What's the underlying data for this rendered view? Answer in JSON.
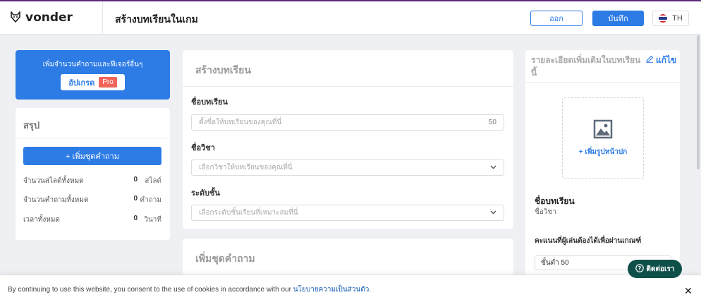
{
  "header": {
    "brand": "vonder",
    "page_title": "สร้างบทเรียนในเกม",
    "exit_label": "ออก",
    "save_label": "บันทึก",
    "language": "TH"
  },
  "upgrade": {
    "text": "เพิ่มจำนวนคำถามและฟีเจอร์อื่นๆ",
    "button_label": "อัปเกรด",
    "badge": "Pro"
  },
  "summary": {
    "title": "สรุป",
    "add_button": "+ เพิ่มชุดคำถาม",
    "stats": [
      {
        "label": "จำนวนสไลด์ทั้งหมด",
        "value": "0",
        "unit": "สไลด์"
      },
      {
        "label": "จำนวนคำถามทั้งหมด",
        "value": "0",
        "unit": "คำถาม"
      },
      {
        "label": "เวลาทั้งหมด",
        "value": "0",
        "unit": "วินาที"
      }
    ]
  },
  "lesson_form": {
    "title": "สร้างบทเรียน",
    "name_label": "ชื่อบทเรียน",
    "name_placeholder": "ตั้งชื่อให้บทเรียนของคุณที่นี่",
    "name_limit": "50",
    "subject_label": "ชื่อวิชา",
    "subject_placeholder": "เลือกวิชาให้บทเรียนของคุณที่นี่",
    "level_label": "ระดับชั้น",
    "level_placeholder": "เลือกระดับชั้นเรียนที่เหมาะสมที่นี่"
  },
  "question_set": {
    "title": "เพิ่มชุดคำถาม"
  },
  "details": {
    "title": "รายละเอียดเพิ่มเติมในบทเรียนนี้",
    "edit_label": "แก้ไข",
    "cover_label": "+ เพิ่มรูปหน้าปก",
    "lesson_name": "ชื่อบทเรียน",
    "subject_name": "ชื่อวิชา",
    "score_label": "คะแนนที่ผู้เล่นต้องได้เพื่อผ่านเกณฑ์",
    "min_score": "ขั้นต่ำ 50"
  },
  "contact": {
    "label": "ติดต่อเรา"
  },
  "cookie": {
    "text": "By continuing to use this website, you consent to the use of cookies in accordance with our ",
    "link": "นโยบายความเป็นส่วนตัว",
    "end": "."
  },
  "colors": {
    "accent": "#2d7be5",
    "pro": "#f0645a",
    "contact": "#0f4f4a"
  }
}
